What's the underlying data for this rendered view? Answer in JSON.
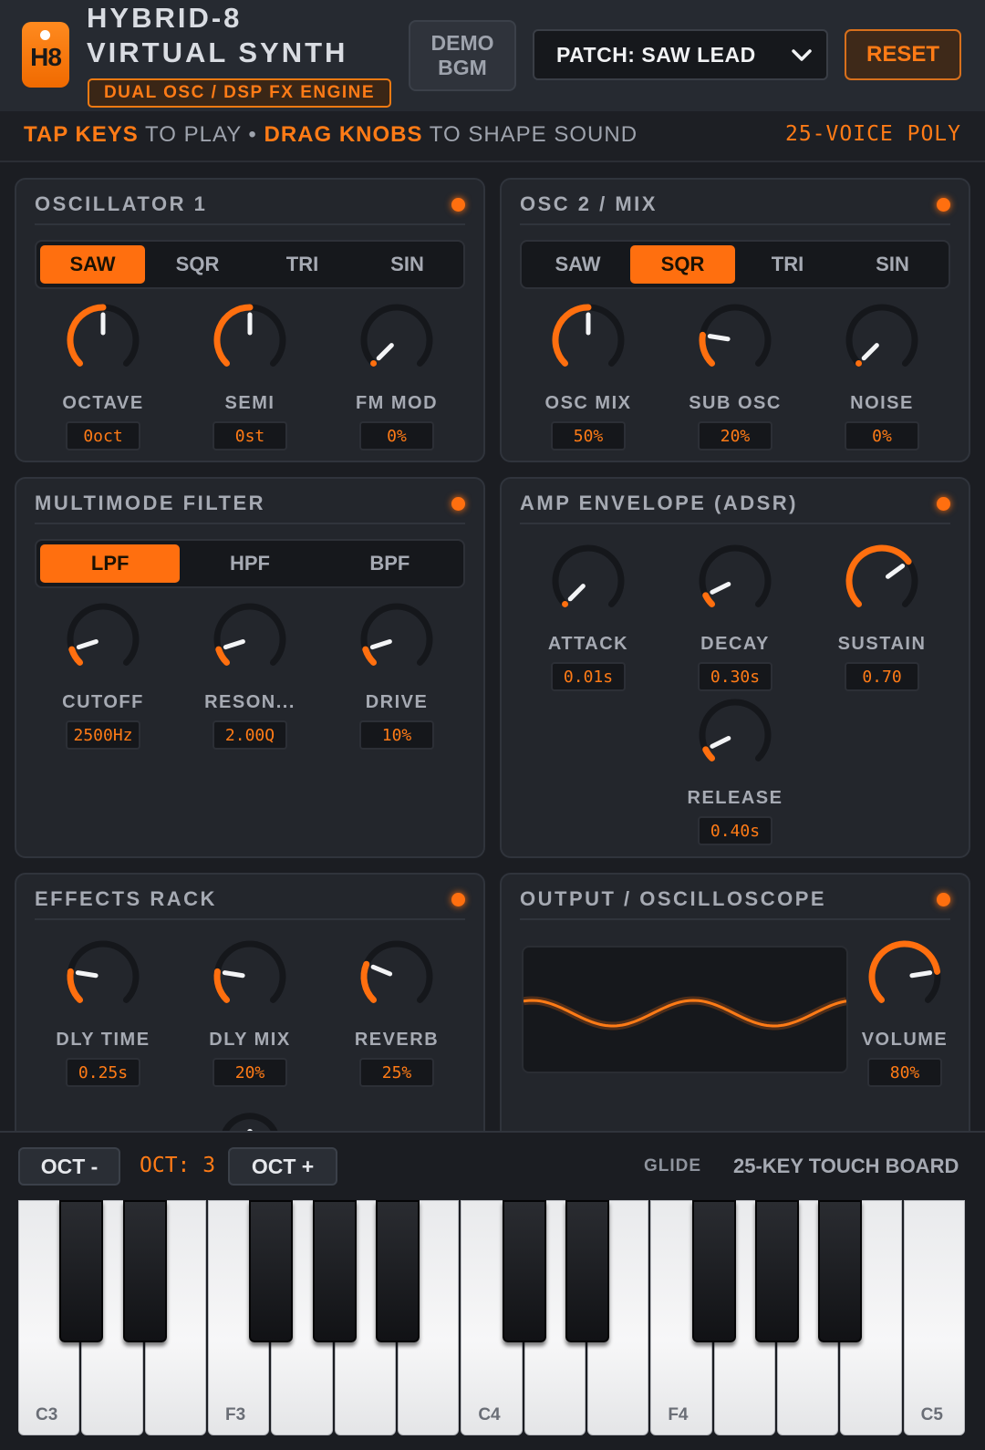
{
  "header": {
    "logo_text": "H8",
    "title_line1": "HYBRID-8",
    "title_line2": "VIRTUAL SYNTH",
    "subtitle": "DUAL OSC / DSP FX ENGINE",
    "demo_line1": "DEMO",
    "demo_line2": "BGM",
    "patch_label": "PATCH: SAW LEAD",
    "reset_label": "RESET"
  },
  "instructions": {
    "tap": "TAP KEYS",
    "to_play": " TO PLAY • ",
    "drag": "DRAG KNOBS",
    "to_shape": " TO SHAPE SOUND",
    "voices": "25-VOICE POLY"
  },
  "osc1": {
    "title": "OSCILLATOR 1",
    "waves": [
      "SAW",
      "SQR",
      "TRI",
      "SIN"
    ],
    "selected": "SAW",
    "knobs": [
      {
        "label": "OCTAVE",
        "value": "0oct",
        "level": 0.5
      },
      {
        "label": "SEMI",
        "value": "0st",
        "level": 0.5
      },
      {
        "label": "FM MOD",
        "value": "0%",
        "level": 0.0
      }
    ]
  },
  "osc2": {
    "title": "OSC 2 / MIX",
    "waves": [
      "SAW",
      "SQR",
      "TRI",
      "SIN"
    ],
    "selected": "SQR",
    "knobs": [
      {
        "label": "OSC MIX",
        "value": "50%",
        "level": 0.5
      },
      {
        "label": "SUB OSC",
        "value": "20%",
        "level": 0.2
      },
      {
        "label": "NOISE",
        "value": "0%",
        "level": 0.0
      }
    ]
  },
  "filter": {
    "title": "MULTIMODE FILTER",
    "modes": [
      "LPF",
      "HPF",
      "BPF"
    ],
    "selected": "LPF",
    "knobs": [
      {
        "label": "CUTOFF",
        "value": "2500Hz",
        "level": 0.1
      },
      {
        "label": "RESON...",
        "value": "2.00Q",
        "level": 0.1
      },
      {
        "label": "DRIVE",
        "value": "10%",
        "level": 0.1
      }
    ]
  },
  "envelope": {
    "title": "AMP ENVELOPE (ADSR)",
    "knobs": [
      {
        "label": "ATTACK",
        "value": "0.01s",
        "level": 0.0
      },
      {
        "label": "DECAY",
        "value": "0.30s",
        "level": 0.07
      },
      {
        "label": "SUSTAIN",
        "value": "0.70",
        "level": 0.7
      },
      {
        "label": "RELEASE",
        "value": "0.40s",
        "level": 0.07
      }
    ]
  },
  "effects": {
    "title": "EFFECTS RACK",
    "knobs": [
      {
        "label": "DLY TIME",
        "value": "0.25s",
        "level": 0.2
      },
      {
        "label": "DLY MIX",
        "value": "20%",
        "level": 0.2
      },
      {
        "label": "REVERB",
        "value": "25%",
        "level": 0.25
      }
    ]
  },
  "output": {
    "title": "OUTPUT / OSCILLOSCOPE",
    "volume_label": "VOLUME",
    "volume_value": "80%",
    "volume_level": 0.8
  },
  "keyboard": {
    "oct_minus": "OCT -",
    "oct_plus": "OCT +",
    "octave_readout": "OCT: 3",
    "glide_label": "GLIDE",
    "board_label": "25-KEY TOUCH BOARD",
    "note_labels": {
      "0": "C3",
      "3": "F3",
      "7": "C4",
      "10": "F4",
      "14": "C5"
    }
  },
  "colors": {
    "accent": "#ff6f0f",
    "panel": "#23262c",
    "background": "#1b1d22"
  }
}
